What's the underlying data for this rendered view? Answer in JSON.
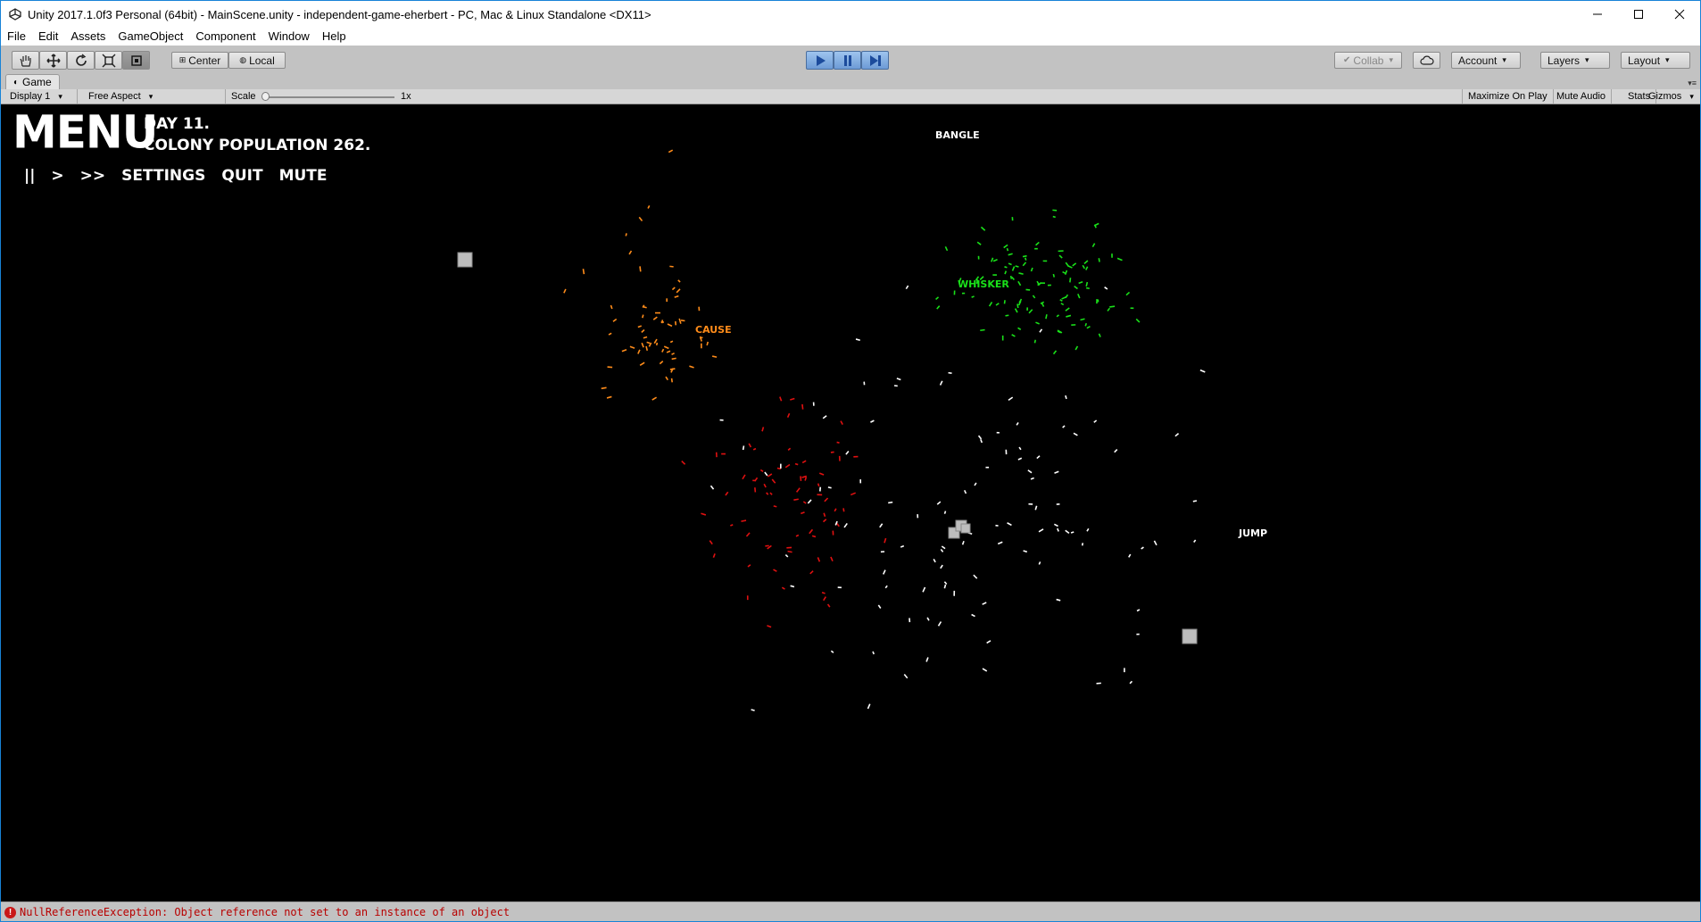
{
  "window": {
    "title": "Unity 2017.1.0f3 Personal (64bit) - MainScene.unity - independent-game-eherbert - PC, Mac & Linux Standalone <DX11>"
  },
  "menu": [
    "File",
    "Edit",
    "Assets",
    "GameObject",
    "Component",
    "Window",
    "Help"
  ],
  "toolbar": {
    "pivot_label": "Center",
    "space_label": "Local",
    "collab_label": "Collab",
    "account_label": "Account",
    "layers_label": "Layers",
    "layout_label": "Layout"
  },
  "game_panel": {
    "tab_label": "Game",
    "display_label": "Display 1",
    "aspect_label": "Free Aspect",
    "scale_label": "Scale",
    "scale_value": "1x",
    "maximize_label": "Maximize On Play",
    "mute_audio_label": "Mute Audio",
    "stats_label": "Stats",
    "gizmos_label": "Gizmos"
  },
  "hud": {
    "menu_label": "MENU",
    "day_text": "DAY 11.",
    "population_text": "COLONY POPULATION 262.",
    "pause_label": "||",
    "play_label": ">",
    "fast_label": ">>",
    "settings_label": "SETTINGS",
    "quit_label": "QUIT",
    "mute_label": "MUTE"
  },
  "colonies": {
    "bangle": "BANGLE",
    "whisker": "WHISKER",
    "cause": "CAUSE",
    "jump": "JUMP"
  },
  "colors": {
    "bangle": "#ffffff",
    "whisker": "#19e119",
    "cause": "#ff8c1a",
    "red": "#e01010",
    "jump": "#ffffff"
  },
  "status": {
    "error_message": "NullReferenceException: Object reference not set to an instance of an object"
  }
}
